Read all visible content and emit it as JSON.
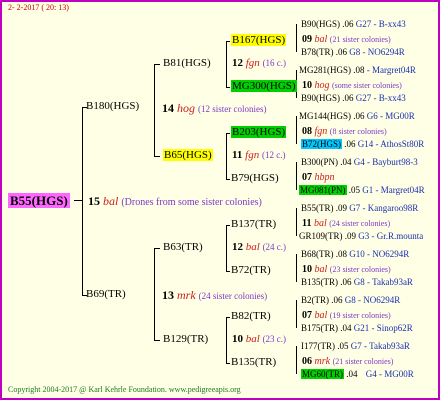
{
  "header": {
    "date": "2- 2-2017 ( 20: 13)"
  },
  "root": {
    "label": "B55(HGS)",
    "year": "15",
    "code": "bal",
    "note": "(Drones from some sister colonies)"
  },
  "g1": [
    {
      "label": "B180(HGS)",
      "year": "14",
      "code": "hog",
      "note": "(12 sister colonies)"
    },
    {
      "label": "B69(TR)",
      "year": "13",
      "code": "mrk",
      "note": "(24 sister colonies)"
    }
  ],
  "g2": [
    {
      "label": "B81(HGS)",
      "year": "12",
      "code": "fgn",
      "note": "(16 c.)"
    },
    {
      "label": "B65(HGS)",
      "year": "11",
      "code": "fgn",
      "note": "(12 c.)"
    },
    {
      "label": "B63(TR)",
      "year": "12",
      "code": "bal",
      "note": "(24 c.)"
    },
    {
      "label": "B129(TR)",
      "year": "10",
      "code": "bal",
      "note": "(23 c.)"
    }
  ],
  "g3": [
    {
      "label": "B167(HGS)",
      "year": "09",
      "code": "bal",
      "note": "(21 sister colonies)"
    },
    {
      "label": "MG300(HGS)",
      "year": "10",
      "code": "hog",
      "note": "(some sister colonies)"
    },
    {
      "label": "B203(HGS)",
      "year": "08",
      "code": "fgn",
      "note": "(8 sister colonies)"
    },
    {
      "label": "B79(HGS)",
      "year": "07",
      "code": "hbpn",
      "note": ""
    },
    {
      "label": "B137(TR)",
      "year": "11",
      "code": "bal",
      "note": "(24 sister colonies)"
    },
    {
      "label": "B72(TR)",
      "year": "10",
      "code": "bal",
      "note": "(23 sister colonies)"
    },
    {
      "label": "B82(TR)",
      "year": "07",
      "code": "bal",
      "note": "(19 sister colonies)"
    },
    {
      "label": "B135(TR)",
      "year": "06",
      "code": "mrk",
      "note": "(21 sister colonies)"
    }
  ],
  "g4": [
    {
      "label": "B90(HGS)",
      "year": ".06",
      "breeder": "G27 - B-xx43"
    },
    {
      "label": "B78(TR)",
      "year": ".06",
      "breeder": "G8 - NO6294R"
    },
    {
      "label": "MG281(HGS)",
      "year": ".08",
      "breeder": "- Margret04R"
    },
    {
      "label": "B90(HGS)",
      "year": ".06",
      "breeder": "G27 - B-xx43"
    },
    {
      "label": "MG144(HGS)",
      "year": ".06",
      "breeder": "G6 - MG00R"
    },
    {
      "label": "B72(HGS)",
      "year": ".06",
      "breeder": "G14 - AthosSt80R"
    },
    {
      "label": "B300(PN)",
      "year": ".04",
      "breeder": "G4 - Bayburt98-3"
    },
    {
      "label": "MG081(PN)",
      "year": ".05",
      "breeder": "G1 - Margret04R"
    },
    {
      "label": "B55(TR)",
      "year": ".09",
      "breeder": "G7 - Kangaroo98R"
    },
    {
      "label": "GR109(TR)",
      "year": ".09",
      "breeder": "G3 - Gr.R.mounta"
    },
    {
      "label": "B68(TR)",
      "year": ".08",
      "breeder": "G10 - NO6294R"
    },
    {
      "label": "B135(TR)",
      "year": ".06",
      "breeder": "G8 - Takab93aR"
    },
    {
      "label": "B2(TR)",
      "year": ".06",
      "breeder": "G8 - NO6294R"
    },
    {
      "label": "B175(TR)",
      "year": ".04",
      "breeder": "G21 - Sinop62R"
    },
    {
      "label": "I177(TR)",
      "year": ".05",
      "breeder": "G7 - Takab93aR"
    },
    {
      "label": "MG60(TR)",
      "year": ".04",
      "breeder": "G4 - MG00R"
    }
  ],
  "footer": {
    "copyright": "Copyright 2004-2017 @ Karl Kehrle Foundation.   www.pedigreeapis.org"
  },
  "colors": {
    "frame": "#c000c0",
    "background": "#ffffe6",
    "root_highlight": "#ff66ff",
    "yellow_highlight": "#ffff00",
    "green_highlight": "#00d000",
    "cyan_highlight": "#00c8ff",
    "mating_code": "#cc1f1f",
    "colony_note": "#7b39c6",
    "breeder": "#1a2fb0",
    "footer": "#1d7a1d"
  }
}
